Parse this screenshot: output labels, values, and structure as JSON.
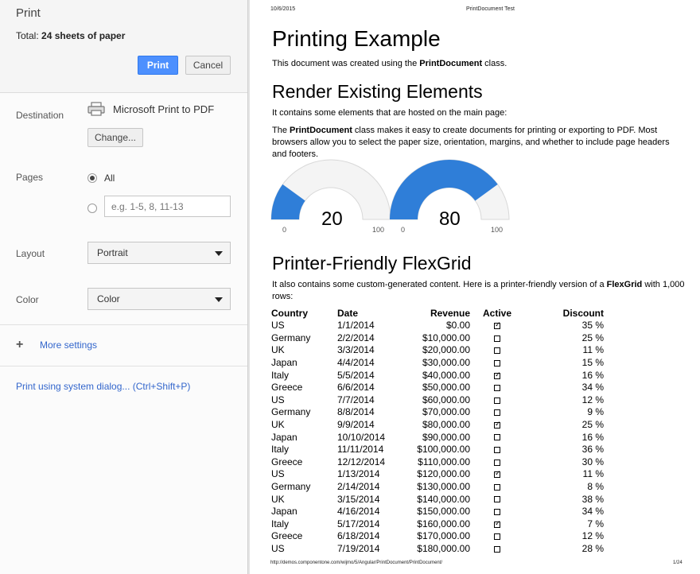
{
  "dialog": {
    "title": "Print",
    "total_prefix": "Total: ",
    "total_value": "24 sheets of paper",
    "print_button": "Print",
    "cancel_button": "Cancel",
    "destination_label": "Destination",
    "destination_name": "Microsoft Print to PDF",
    "change_button": "Change...",
    "pages_label": "Pages",
    "pages_all": "All",
    "pages_placeholder": "e.g. 1-5, 8, 11-13",
    "layout_label": "Layout",
    "layout_value": "Portrait",
    "color_label": "Color",
    "color_value": "Color",
    "more_settings": "More settings",
    "system_dialog": "Print using system dialog... (Ctrl+Shift+P)",
    "accent_color": "#4d90fe",
    "link_color": "#3366cc"
  },
  "preview": {
    "header_date": "10/6/2015",
    "header_title": "PrintDocument Test",
    "h1": "Printing Example",
    "intro_pre": "This document was created using the ",
    "intro_bold": "PrintDocument",
    "intro_post": " class.",
    "h2_render": "Render Existing Elements",
    "render_p1": "It contains some elements that are hosted on the main page:",
    "render_p2_pre": "The ",
    "render_p2_bold": "PrintDocument",
    "render_p2_post": " class makes it easy to create documents for printing or exporting to PDF. Most browsers allow you to select the paper size, orientation, margins, and whether to include page headers and footers.",
    "gauges": [
      {
        "value": 20,
        "min": "0",
        "max": "100",
        "label": "20"
      },
      {
        "value": 80,
        "min": "0",
        "max": "100",
        "label": "80"
      }
    ],
    "gauge_color": "#2f7ed8",
    "h2_flex": "Printer-Friendly FlexGrid",
    "flex_p_pre": "It also contains some custom-generated content. Here is a printer-friendly version of a ",
    "flex_p_bold": "FlexGrid",
    "flex_p_post": " with 1,000 rows:",
    "grid": {
      "headers": [
        "Country",
        "Date",
        "Revenue",
        "Active",
        "Discount"
      ],
      "rows": [
        [
          "US",
          "1/1/2014",
          "$0.00",
          true,
          "35 %"
        ],
        [
          "Germany",
          "2/2/2014",
          "$10,000.00",
          false,
          "25 %"
        ],
        [
          "UK",
          "3/3/2014",
          "$20,000.00",
          false,
          "11 %"
        ],
        [
          "Japan",
          "4/4/2014",
          "$30,000.00",
          false,
          "15 %"
        ],
        [
          "Italy",
          "5/5/2014",
          "$40,000.00",
          true,
          "16 %"
        ],
        [
          "Greece",
          "6/6/2014",
          "$50,000.00",
          false,
          "34 %"
        ],
        [
          "US",
          "7/7/2014",
          "$60,000.00",
          false,
          "12 %"
        ],
        [
          "Germany",
          "8/8/2014",
          "$70,000.00",
          false,
          "9 %"
        ],
        [
          "UK",
          "9/9/2014",
          "$80,000.00",
          true,
          "25 %"
        ],
        [
          "Japan",
          "10/10/2014",
          "$90,000.00",
          false,
          "16 %"
        ],
        [
          "Italy",
          "11/11/2014",
          "$100,000.00",
          false,
          "36 %"
        ],
        [
          "Greece",
          "12/12/2014",
          "$110,000.00",
          false,
          "30 %"
        ],
        [
          "US",
          "1/13/2014",
          "$120,000.00",
          true,
          "11 %"
        ],
        [
          "Germany",
          "2/14/2014",
          "$130,000.00",
          false,
          "8 %"
        ],
        [
          "UK",
          "3/15/2014",
          "$140,000.00",
          false,
          "38 %"
        ],
        [
          "Japan",
          "4/16/2014",
          "$150,000.00",
          false,
          "34 %"
        ],
        [
          "Italy",
          "5/17/2014",
          "$160,000.00",
          true,
          "7 %"
        ],
        [
          "Greece",
          "6/18/2014",
          "$170,000.00",
          false,
          "12 %"
        ],
        [
          "US",
          "7/19/2014",
          "$180,000.00",
          false,
          "28 %"
        ]
      ]
    },
    "footer_url": "http://demos.componentone.com/wijmo/5/Angular/PrintDocument/PrintDocument/",
    "footer_page": "1/24"
  }
}
